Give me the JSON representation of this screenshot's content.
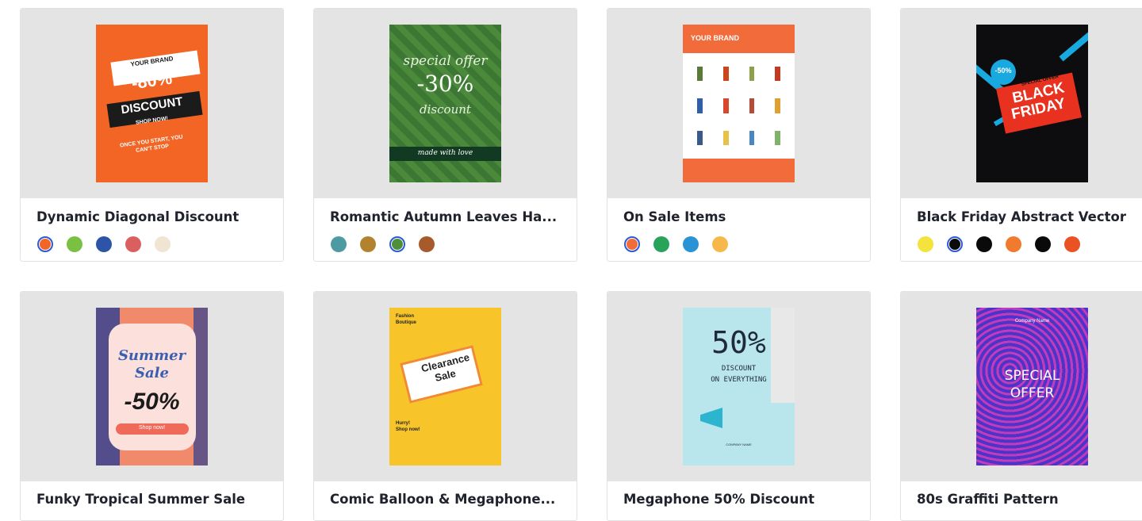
{
  "cards": [
    {
      "title": "Dynamic Diagonal Discount",
      "poster": {
        "brand": "YOUR BRAND",
        "discount": "-80%",
        "headline": "DISCOUNT",
        "cta": "SHOP NOW!",
        "tagline": "ONCE YOU START, YOU CAN'T STOP"
      },
      "swatches": [
        "#f26524",
        "#7ac143",
        "#2d54a6",
        "#d9605f",
        "#efe5d2"
      ],
      "selected": 0
    },
    {
      "title": "Romantic Autumn Leaves Ha...",
      "poster": {
        "line1": "special offer",
        "discount": "-30%",
        "line2": "discount",
        "footer": "made with love"
      },
      "swatches": [
        "#4e9aa3",
        "#b2822f",
        "#4f8f3a",
        "#a75a2c"
      ],
      "selected": 2
    },
    {
      "title": "On Sale Items",
      "poster": {
        "brand": "YOUR BRAND"
      },
      "swatches": [
        "#f26b3a",
        "#2aa35a",
        "#2a93d5",
        "#f6b84a"
      ],
      "selected": 0
    },
    {
      "title": "Black Friday Abstract Vector",
      "poster": {
        "badge": "-50%",
        "special": "SPECIAL OFFER",
        "line1": "BLACK",
        "line2": "FRIDAY"
      },
      "swatches": [
        "#f3e33c",
        "#0a0a0a",
        "#0a0a0a",
        "#f07a2e",
        "#0a0a0a",
        "#ea5223"
      ],
      "selected": 1
    },
    {
      "title": "Funky Tropical Summer Sale",
      "poster": {
        "line1": "Summer",
        "line2": "Sale",
        "discount": "-50%",
        "cta": "Shop now!"
      }
    },
    {
      "title": "Comic Balloon & Megaphone...",
      "poster": {
        "brand1": "Fashion",
        "brand2": "Boutique",
        "line1": "Clearance",
        "line2": "Sale",
        "hurry1": "Hurry!",
        "hurry2": "Shop now!"
      }
    },
    {
      "title": "Megaphone 50% Discount",
      "poster": {
        "big": "50%",
        "line1": "DISCOUNT",
        "line2": "ON EVERYTHING",
        "company": "COMPANY NAME"
      }
    },
    {
      "title": "80s Graffiti Pattern",
      "poster": {
        "line1": "SPECIAL",
        "line2": "OFFER",
        "company": "Company Name"
      }
    }
  ]
}
